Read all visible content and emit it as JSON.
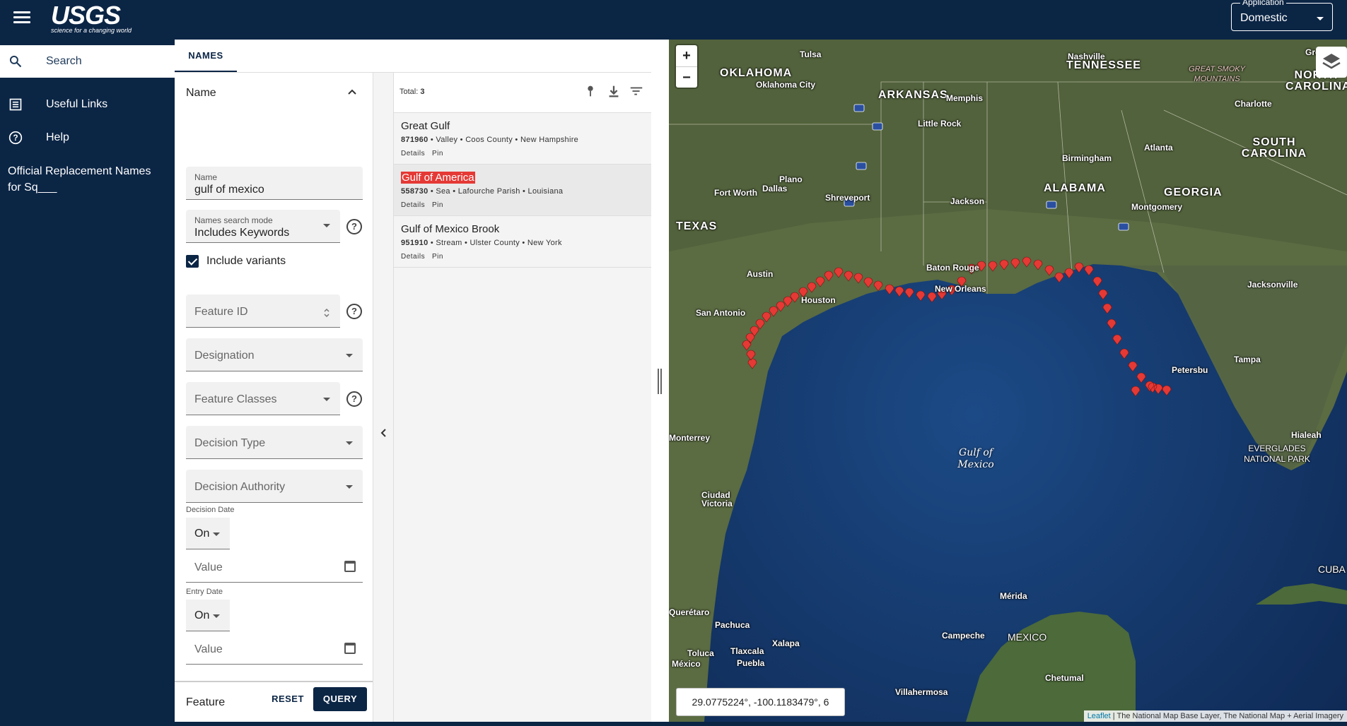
{
  "header": {
    "logo_word": "USGS",
    "logo_tagline": "science for a changing world",
    "application_label": "Application",
    "application_value": "Domestic"
  },
  "sidebar": {
    "search_label": "Search",
    "items": [
      {
        "label": "Useful Links",
        "icon": "list-icon"
      },
      {
        "label": "Help",
        "icon": "help-circle-icon"
      }
    ],
    "extra_text": "Official Replacement Names for Sq___"
  },
  "tabs": [
    {
      "label": "NAMES",
      "active": true
    }
  ],
  "form": {
    "name_section_title": "Name",
    "name_field_label": "Name",
    "name_field_value": "gulf of mexico",
    "search_mode_label": "Names search mode",
    "search_mode_value": "Includes Keywords",
    "include_variants_label": "Include variants",
    "include_variants_checked": true,
    "feature_id_placeholder": "Feature ID",
    "designation_placeholder": "Designation",
    "feature_classes_placeholder": "Feature Classes",
    "decision_type_placeholder": "Decision Type",
    "decision_authority_placeholder": "Decision Authority",
    "decision_date_label": "Decision Date",
    "decision_date_op": "On",
    "decision_date_placeholder": "Value",
    "entry_date_label": "Entry Date",
    "entry_date_op": "On",
    "entry_date_placeholder": "Value",
    "feature_section_title": "Feature",
    "reset_label": "RESET",
    "query_label": "QUERY"
  },
  "results": {
    "total_label": "Total:",
    "total_value": "3",
    "items": [
      {
        "name": "Great Gulf",
        "id": "871960",
        "details": "• Valley • Coos County • New Hampshire",
        "highlighted": false
      },
      {
        "name": "Gulf of America",
        "id": "558730",
        "details": "• Sea • Lafourche Parish • Louisiana",
        "highlighted": true
      },
      {
        "name": "Gulf of Mexico Brook",
        "id": "951910",
        "details": "• Stream • Ulster County • New York",
        "highlighted": false
      }
    ],
    "details_label": "Details",
    "pin_label": "Pin"
  },
  "map": {
    "zoom_in": "+",
    "zoom_out": "−",
    "gulf_label_1": "Gulf of",
    "gulf_label_2": "Mexico",
    "coordinates": "29.0775224°, -100.1183479°, 6",
    "attribution_leaflet": "Leaflet",
    "attribution_rest": "| The National Map Base Layer, The National Map + Aerial Imagery",
    "marker_color": "#e53935",
    "labels": [
      {
        "text": "OKLAHOMA",
        "size": "lg"
      },
      {
        "text": "ARKANSAS",
        "size": "lg"
      },
      {
        "text": "TENNESSEE",
        "size": "lg"
      },
      {
        "text": "NORTH CAROLINA",
        "size": "lg"
      },
      {
        "text": "SOUTH CAROLINA",
        "size": "lg"
      },
      {
        "text": "ALABAMA",
        "size": "lg"
      },
      {
        "text": "GEORGIA",
        "size": "lg"
      },
      {
        "text": "TEXAS",
        "size": "lg"
      },
      {
        "text": "MEXICO",
        "size": "sm"
      },
      {
        "text": "CUBA",
        "size": "sm"
      },
      {
        "text": "Tulsa",
        "size": "sm"
      },
      {
        "text": "Oklahoma City",
        "size": "sm"
      },
      {
        "text": "Nashville",
        "size": "sm"
      },
      {
        "text": "Memphis",
        "size": "sm"
      },
      {
        "text": "Little Rock",
        "size": "sm"
      },
      {
        "text": "Charlotte",
        "size": "sm"
      },
      {
        "text": "Greensb",
        "size": "sm"
      },
      {
        "text": "Atlanta",
        "size": "sm"
      },
      {
        "text": "Birmingham",
        "size": "sm"
      },
      {
        "text": "Dallas",
        "size": "sm"
      },
      {
        "text": "Plano",
        "size": "sm"
      },
      {
        "text": "Fort Worth",
        "size": "sm"
      },
      {
        "text": "Shreveport",
        "size": "sm"
      },
      {
        "text": "Jackson",
        "size": "sm"
      },
      {
        "text": "Montgomery",
        "size": "sm"
      },
      {
        "text": "Baton Rouge",
        "size": "sm"
      },
      {
        "text": "New Orleans",
        "size": "sm"
      },
      {
        "text": "Houston",
        "size": "sm"
      },
      {
        "text": "Austin",
        "size": "sm"
      },
      {
        "text": "San Antonio",
        "size": "sm"
      },
      {
        "text": "Jacksonville",
        "size": "sm"
      },
      {
        "text": "Tampa",
        "size": "sm"
      },
      {
        "text": "Petersbu",
        "size": "sm"
      },
      {
        "text": "Hialeah",
        "size": "sm"
      },
      {
        "text": "EVERGLADES NATIONAL PARK",
        "size": "sm"
      },
      {
        "text": "Monterrey",
        "size": "sm"
      },
      {
        "text": "Ciudad Victoria",
        "size": "sm"
      },
      {
        "text": "Mérida",
        "size": "sm"
      },
      {
        "text": "Campeche",
        "size": "sm"
      },
      {
        "text": "Chetumal",
        "size": "sm"
      },
      {
        "text": "Villahermosa",
        "size": "sm"
      },
      {
        "text": "Pachuca",
        "size": "sm"
      },
      {
        "text": "Xalapa",
        "size": "sm"
      },
      {
        "text": "Toluca",
        "size": "sm"
      },
      {
        "text": "Tlaxcala",
        "size": "sm"
      },
      {
        "text": "Puebla",
        "size": "sm"
      },
      {
        "text": "México",
        "size": "sm"
      },
      {
        "text": "Querétaro",
        "size": "sm"
      },
      {
        "text": "GREAT SMOKY MOUNTAINS",
        "size": "sm"
      }
    ]
  }
}
